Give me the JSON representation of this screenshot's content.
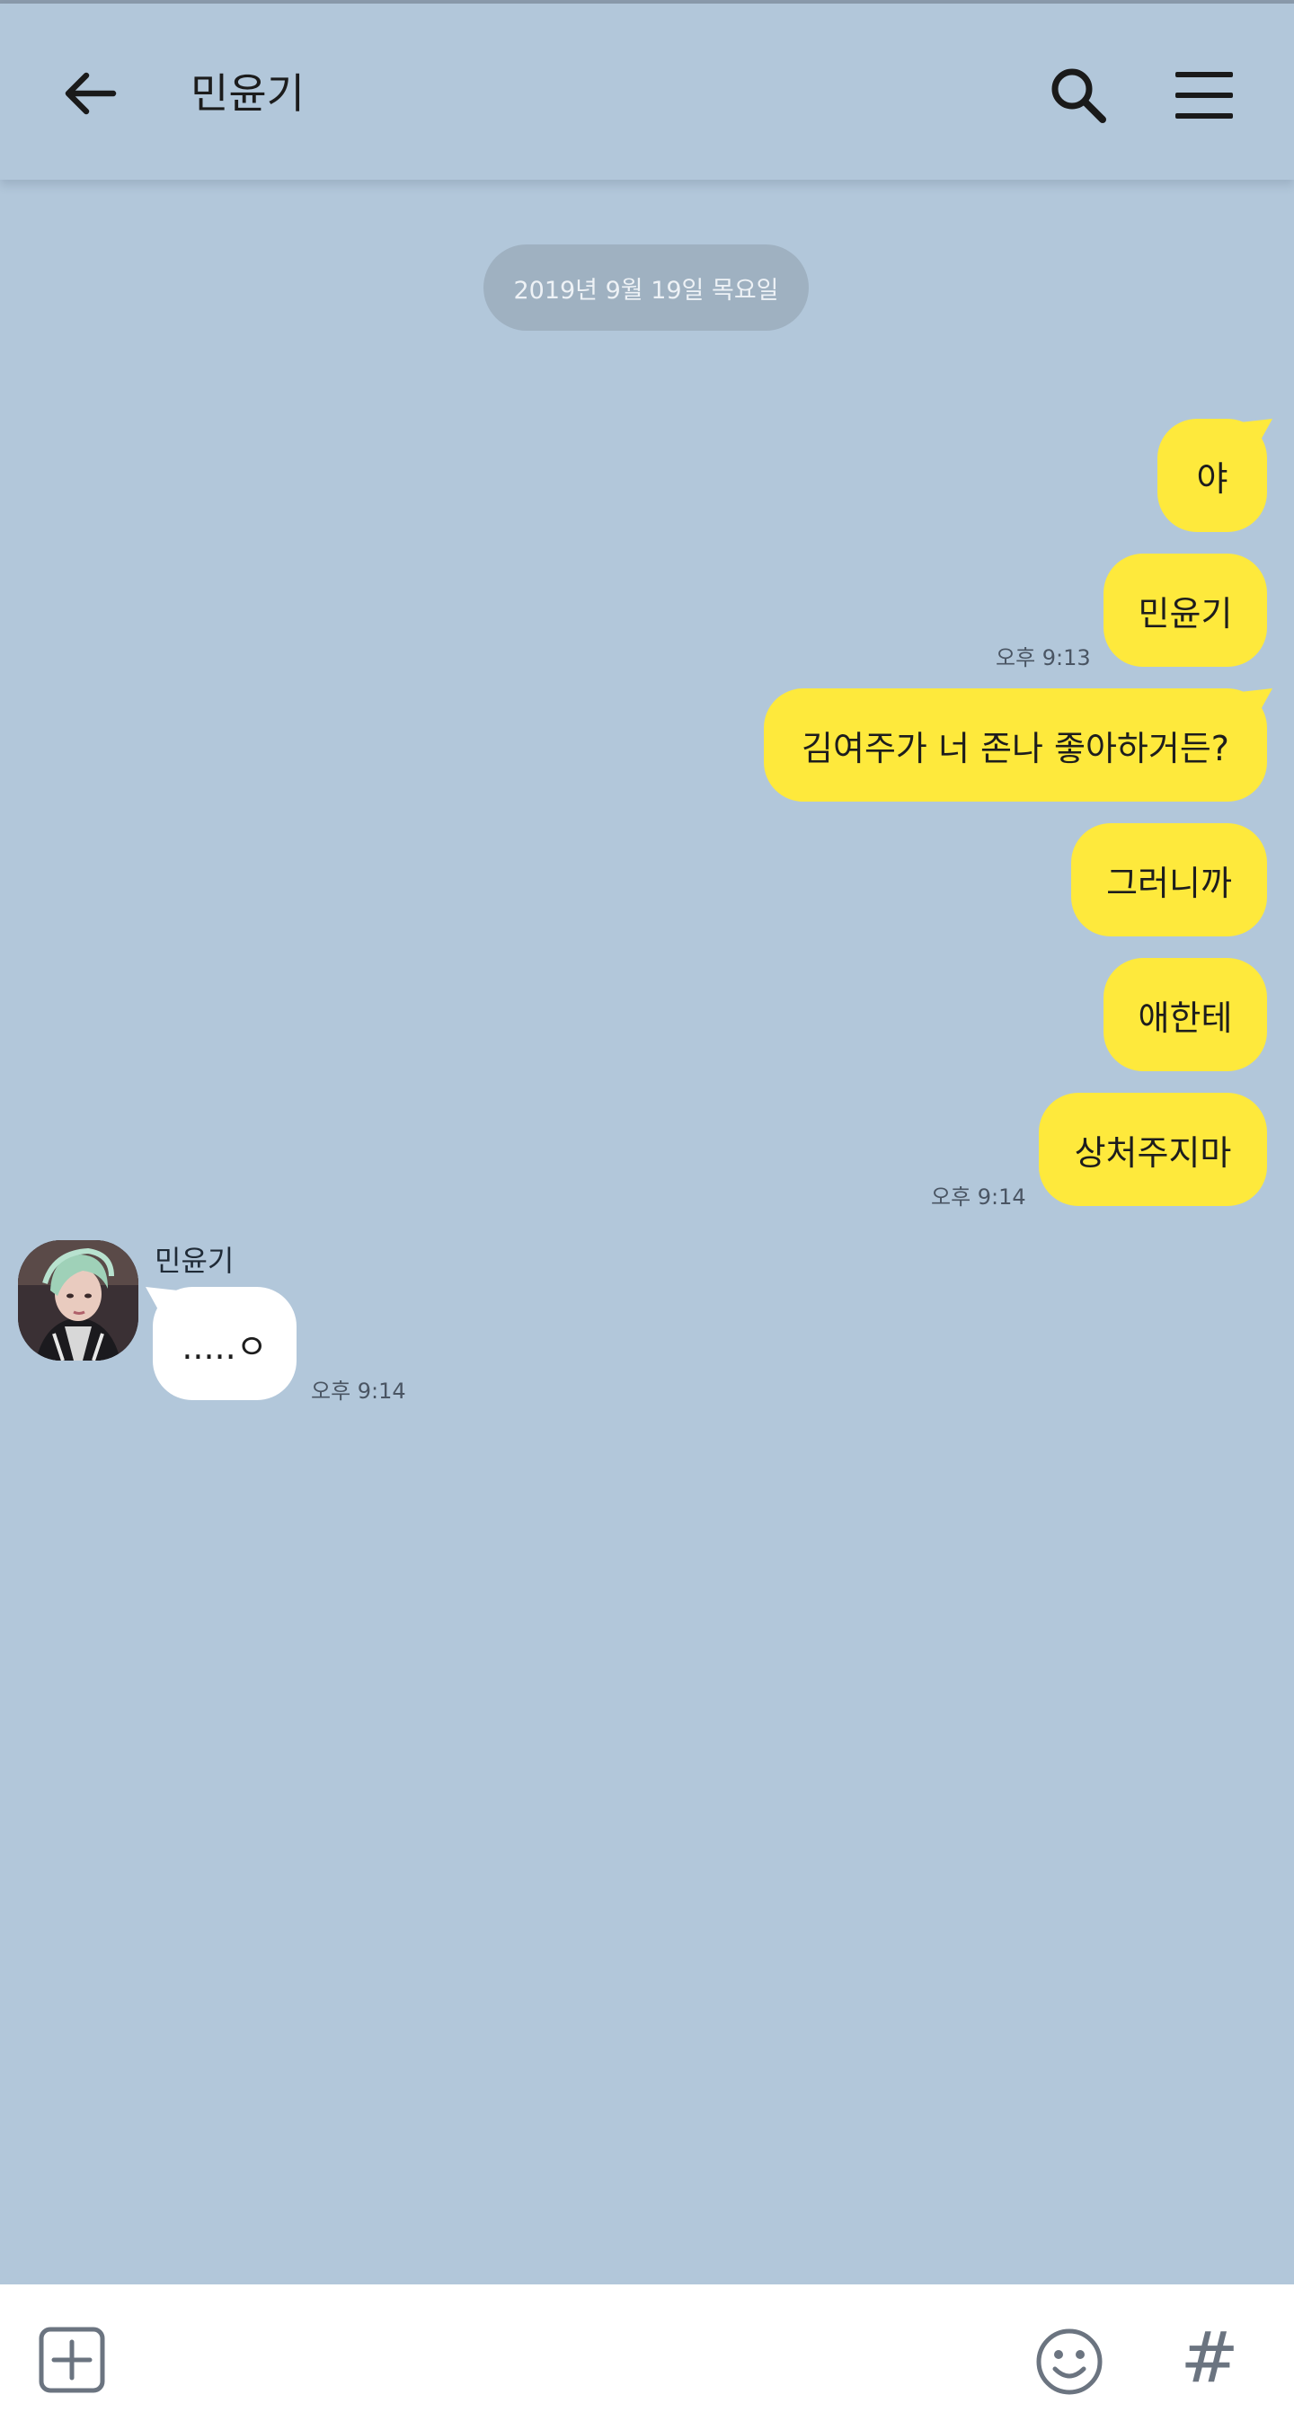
{
  "header": {
    "title": "민윤기",
    "back_icon": "arrow-left-icon",
    "search_icon": "search-icon",
    "menu_icon": "hamburger-menu-icon"
  },
  "date_divider": "2019년 9월 19일 목요일",
  "messages": [
    {
      "from": "me",
      "text": "야"
    },
    {
      "from": "me",
      "text": "민윤기",
      "time": "오후 9:13"
    },
    {
      "from": "me",
      "text": "김여주가 너 존나 좋아하거든?"
    },
    {
      "from": "me",
      "text": "그러니까"
    },
    {
      "from": "me",
      "text": "애한테"
    },
    {
      "from": "me",
      "text": "상처주지마",
      "time": "오후 9:14"
    },
    {
      "from": "other",
      "sender": "민윤기",
      "text": ".....ㅇ",
      "time": "오후 9:14"
    }
  ],
  "bottom_bar": {
    "plus_icon": "plus-square-icon",
    "emoji_icon": "smiley-icon",
    "hash_label": "#"
  },
  "colors": {
    "background": "#b2c7da",
    "my_bubble": "#fee93c",
    "their_bubble": "#ffffff",
    "date_pill": "#9fb1c1"
  }
}
